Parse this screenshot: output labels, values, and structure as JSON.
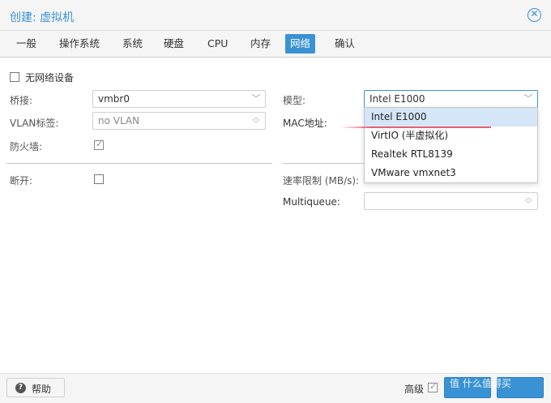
{
  "window": {
    "title": "创建: 虚拟机"
  },
  "tabs": [
    {
      "label": "一般"
    },
    {
      "label": "操作系统"
    },
    {
      "label": "系统"
    },
    {
      "label": "硬盘"
    },
    {
      "label": "CPU"
    },
    {
      "label": "内存"
    },
    {
      "label": "网络",
      "active": true
    },
    {
      "label": "确认"
    }
  ],
  "form": {
    "no_network_label": "无网络设备",
    "bridge_label": "桥接:",
    "bridge_value": "vmbr0",
    "vlan_label": "VLAN标签:",
    "vlan_value": "no VLAN",
    "firewall_label": "防火墙:",
    "model_label": "模型:",
    "model_value": "Intel E1000",
    "mac_label": "MAC地址:",
    "disconnect_label": "断开:",
    "rate_label": "速率限制 (MB/s):",
    "multiqueue_label": "Multiqueue:"
  },
  "dropdown": {
    "options": [
      "Intel E1000",
      "VirtIO (半虚拟化)",
      "Realtek RTL8139",
      "VMware vmxnet3"
    ],
    "selected_index": 0
  },
  "footer": {
    "help_label": "帮助",
    "advanced_label": "高级",
    "watermark": "值 什么值得买"
  },
  "colors": {
    "accent": "#3892d4",
    "annotation": "#e65064"
  },
  "icons": {
    "close": "close-circle-icon",
    "help": "help-circle-icon",
    "dropdown": "chevron-down-icon",
    "spinner": "spinner-arrows-icon"
  }
}
